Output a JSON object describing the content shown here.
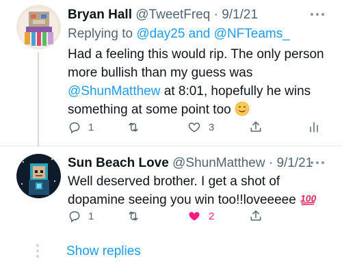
{
  "tweets": [
    {
      "name": "Bryan Hall",
      "handle": "@TweetFreq",
      "separator": "·",
      "date": "9/1/21",
      "replying_to_prefix": "Replying to",
      "replying_to_users": "@day25 and @NFTeams_",
      "text_part1": "Had a feeling this would rip. The only person more bullish than my guess was",
      "mention": "@ShunMatthew",
      "text_part2": "at 8:01, hopefully he wins something at some point too",
      "emoji": "smiling-face-icon",
      "replies": "1",
      "retweets": "",
      "likes": "3",
      "liked": false
    },
    {
      "name": "Sun Beach Love",
      "handle": "@ShunMatthew",
      "separator": "·",
      "date": "9/1/21",
      "text": "Well deserved brother. I get a shot of dopamine seeing you win too!!loveeeee",
      "emoji": "hundred-points-icon",
      "replies": "1",
      "retweets": "",
      "likes": "2",
      "liked": true
    }
  ],
  "show_replies": "Show replies",
  "colors": {
    "link": "#1d9bf0",
    "like_active": "#f91880",
    "secondary_text": "#536471"
  }
}
